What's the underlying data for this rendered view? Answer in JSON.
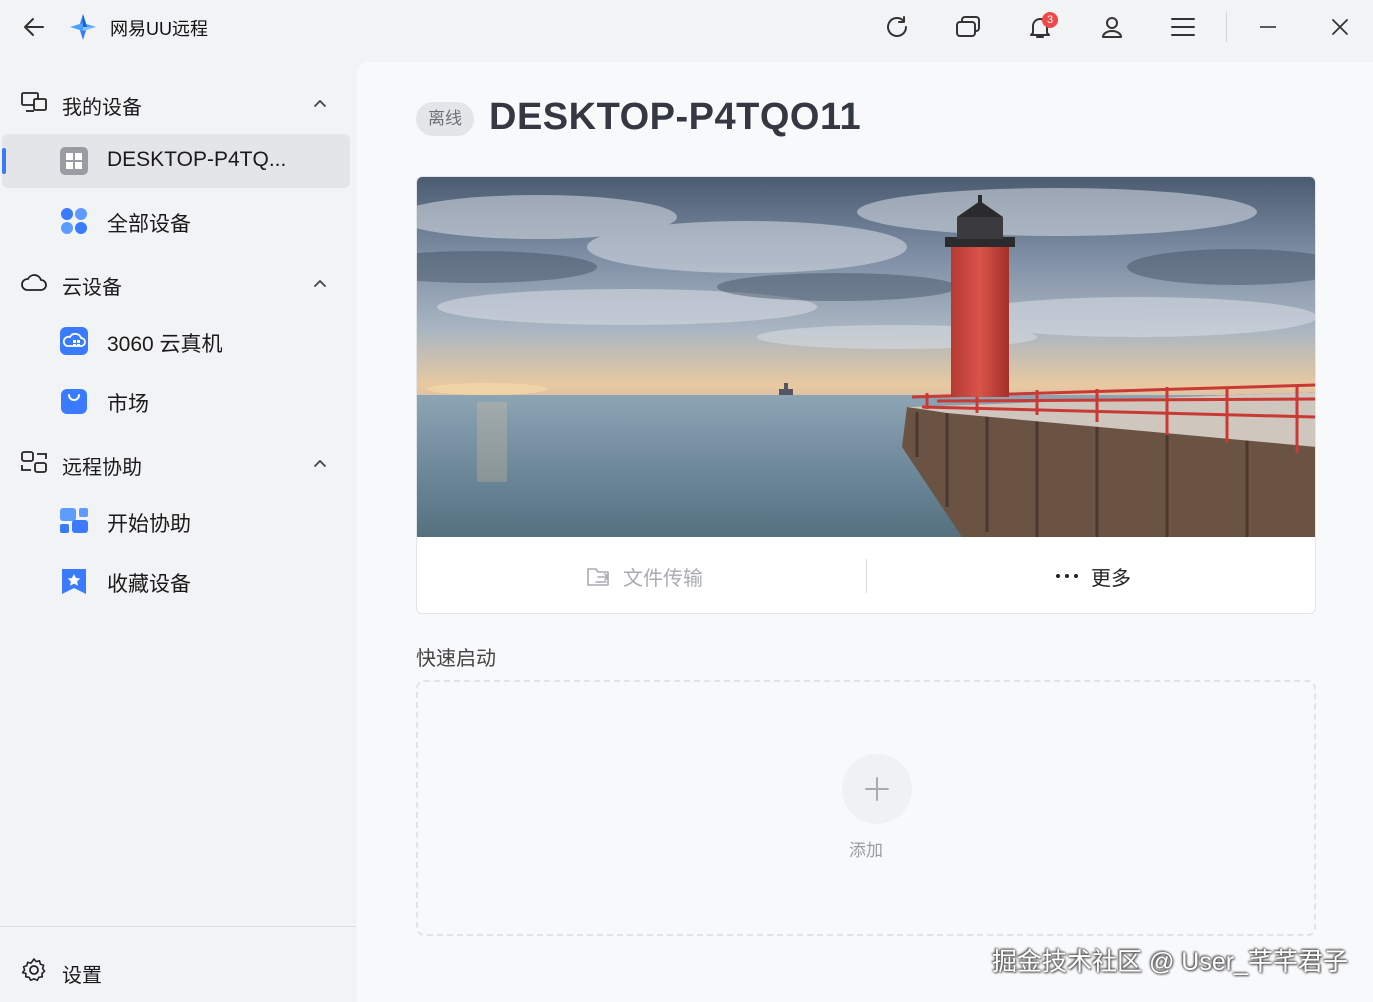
{
  "app": {
    "title": "网易UU远程",
    "notification_count": "3"
  },
  "sidebar": {
    "groups": [
      {
        "label": "我的设备",
        "items": [
          {
            "label": "DESKTOP-P4TQ...",
            "active": true
          },
          {
            "label": "全部设备"
          }
        ]
      },
      {
        "label": "云设备",
        "items": [
          {
            "label": "3060 云真机"
          },
          {
            "label": "市场"
          }
        ]
      },
      {
        "label": "远程协助",
        "items": [
          {
            "label": "开始协助"
          },
          {
            "label": "收藏设备"
          }
        ]
      }
    ],
    "settings_label": "设置"
  },
  "device": {
    "status": "离线",
    "name": "DESKTOP-P4TQO11",
    "actions": {
      "file_transfer": "文件传输",
      "more": "更多"
    }
  },
  "quick_launch": {
    "title": "快速启动",
    "add_label": "添加"
  },
  "watermark": "掘金技术社区 @ User_芊芊君子",
  "colors": {
    "accent": "#3a7afe",
    "badge": "#f04848",
    "sidebar_bg": "#f2f3f5",
    "main_bg": "#f8f9fb"
  }
}
